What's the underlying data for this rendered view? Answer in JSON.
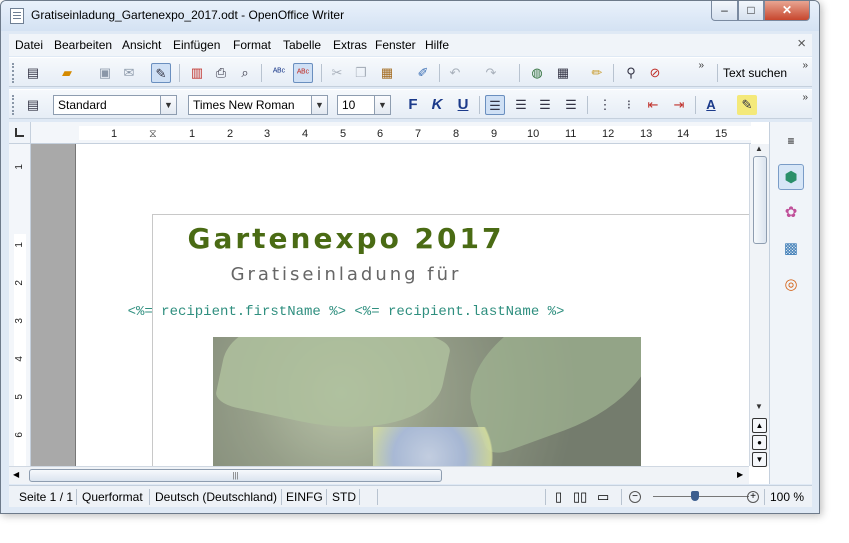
{
  "window": {
    "title": "Gratiseinladung_Gartenexpo_2017.odt - OpenOffice Writer",
    "min_label": "–",
    "max_label": "□",
    "close_label": "✕"
  },
  "menubar": {
    "items": [
      "Datei",
      "Bearbeiten",
      "Ansicht",
      "Einfügen",
      "Format",
      "Tabelle",
      "Extras",
      "Fenster",
      "Hilfe"
    ],
    "close_label": "×"
  },
  "toolbar_standard": {
    "search_label": "Text suchen"
  },
  "toolbar_format": {
    "paragraph_style": "Standard",
    "font_name": "Times New Roman",
    "font_size": "10",
    "bold_label": "F",
    "italic_label": "K",
    "underline_label": "U"
  },
  "ruler": {
    "h_ticks": [
      "1",
      "1",
      "2",
      "3",
      "4",
      "5",
      "6",
      "7",
      "8",
      "9",
      "10",
      "11",
      "12",
      "13",
      "14",
      "15"
    ],
    "v_ticks": [
      "1",
      "1",
      "2",
      "3",
      "4",
      "5",
      "6"
    ]
  },
  "document": {
    "heading": "Gartenexpo 2017",
    "subheading": "Gratiseinladung für",
    "template_line": "<%= recipient.firstName %> <%= recipient.lastName %>"
  },
  "statusbar": {
    "page": "Seite 1 / 1",
    "orientation": "Querformat",
    "language": "Deutsch (Deutschland)",
    "insert_mode": "EINFG",
    "selection_mode": "STD",
    "zoom": "100 %"
  },
  "zoom": {
    "level_percent": 100
  },
  "colors": {
    "heading": "#4a6b14",
    "template": "#2f8f7f",
    "subheading": "#666666"
  }
}
